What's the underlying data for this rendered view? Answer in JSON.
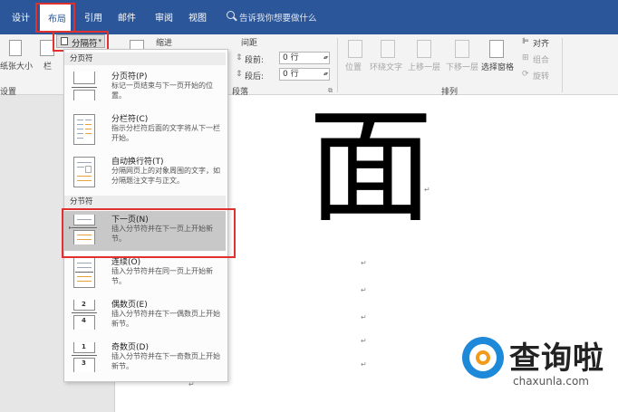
{
  "tabs": [
    "设计",
    "布局",
    "引用",
    "邮件",
    "审阅",
    "视图"
  ],
  "search": {
    "placeholder": "告诉我你想要做什么"
  },
  "ribbon": {
    "breaks_label": "分隔符",
    "paper_size": "纸张大小",
    "columns": "栏",
    "page_setup": "设置",
    "indent": "缩进",
    "spacing": "间距",
    "before_label": "段前:",
    "before_value": "0 行",
    "after_label": "段后:",
    "after_value": "0 行",
    "paragraph": "段落",
    "position": "位置",
    "wrap_text": "环绕文字",
    "bring_forward": "上移一层",
    "send_backward": "下移一层",
    "selection_pane": "选择窗格",
    "align": "对齐",
    "group": "组合",
    "rotate": "旋转",
    "arrange": "排列"
  },
  "dropdown": {
    "page_breaks_header": "分页符",
    "section_breaks_header": "分节符",
    "items": [
      {
        "title": "分页符(P)",
        "desc": "标记一页结束与下一页开始的位置。"
      },
      {
        "title": "分栏符(C)",
        "desc": "指示分栏符后面的文字将从下一栏开始。"
      },
      {
        "title": "自动换行符(T)",
        "desc": "分隔网页上的对象周围的文字，如分隔题注文字与正文。"
      },
      {
        "title": "下一页(N)",
        "desc": "插入分节符并在下一页上开始新节。"
      },
      {
        "title": "连续(O)",
        "desc": "插入分节符并在同一页上开始新节。"
      },
      {
        "title": "偶数页(E)",
        "desc": "插入分节符并在下一偶数页上开始新节。"
      },
      {
        "title": "奇数页(D)",
        "desc": "插入分节符并在下一奇数页上开始新节。"
      }
    ],
    "page_numbers": {
      "even": [
        "2",
        "4"
      ],
      "odd": [
        "1",
        "3"
      ]
    }
  },
  "document": {
    "big_char": "面",
    "para_mark": "↵"
  },
  "watermark": {
    "name": "查询啦",
    "url": "chaxunla.com"
  },
  "colors": {
    "ribbon_blue": "#2b579a",
    "highlight_red": "#e03030",
    "logo_blue": "#1e88d9",
    "logo_orange": "#f29a1b"
  }
}
